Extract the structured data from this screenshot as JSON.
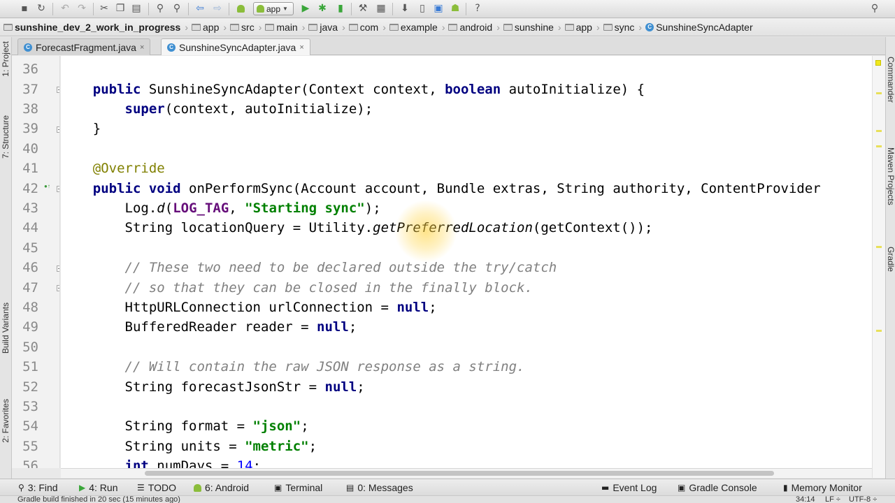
{
  "toolbar": {
    "run_config": "app",
    "icons": [
      "save-icon",
      "sync-icon",
      "undo-icon",
      "redo-icon",
      "cut-icon",
      "copy-icon",
      "paste-icon",
      "find-icon",
      "replace-icon",
      "back-icon",
      "forward-icon",
      "android-icon",
      "run-icon",
      "debug-icon",
      "attach-icon",
      "build-icon",
      "project-structure-icon",
      "sdk-manager-icon",
      "avd-manager-icon",
      "android-monitor-icon",
      "help-icon",
      "search-everywhere-icon"
    ]
  },
  "breadcrumb": [
    "sunshine_dev_2_work_in_progress",
    "app",
    "src",
    "main",
    "java",
    "com",
    "example",
    "android",
    "sunshine",
    "app",
    "sync",
    "SunshineSyncAdapter"
  ],
  "editor_tabs": [
    {
      "label": "ForecastFragment.java",
      "close": "×"
    },
    {
      "label": "SunshineSyncAdapter.java",
      "close": "×"
    }
  ],
  "left_tabs": {
    "project": "1: Project",
    "structure": "7: Structure",
    "build_variants": "Build Variants",
    "favorites": "2: Favorites"
  },
  "right_tabs": {
    "commander": "Commander",
    "maven": "Maven Projects",
    "gradle": "Gradle"
  },
  "code_lines": [
    {
      "num": "36",
      "text": ""
    },
    {
      "num": "37",
      "text": "public SunshineSyncAdapter(Context context, boolean autoInitialize) {"
    },
    {
      "num": "38",
      "text": "    super(context, autoInitialize);"
    },
    {
      "num": "39",
      "text": "}"
    },
    {
      "num": "40",
      "text": ""
    },
    {
      "num": "41",
      "text": "@Override"
    },
    {
      "num": "42",
      "text": "public void onPerformSync(Account account, Bundle extras, String authority, ContentProvider"
    },
    {
      "num": "43",
      "text": "    Log.d(LOG_TAG, \"Starting sync\");"
    },
    {
      "num": "44",
      "text": "    String locationQuery = Utility.getPreferredLocation(getContext());"
    },
    {
      "num": "45",
      "text": ""
    },
    {
      "num": "46",
      "text": "    // These two need to be declared outside the try/catch"
    },
    {
      "num": "47",
      "text": "    // so that they can be closed in the finally block."
    },
    {
      "num": "48",
      "text": "    HttpURLConnection urlConnection = null;"
    },
    {
      "num": "49",
      "text": "    BufferedReader reader = null;"
    },
    {
      "num": "50",
      "text": ""
    },
    {
      "num": "51",
      "text": "    // Will contain the raw JSON response as a string."
    },
    {
      "num": "52",
      "text": "    String forecastJsonStr = null;"
    },
    {
      "num": "53",
      "text": ""
    },
    {
      "num": "54",
      "text": "    String format = \"json\";"
    },
    {
      "num": "55",
      "text": "    String units = \"metric\";"
    },
    {
      "num": "56",
      "text": "    int numDays = 14;"
    }
  ],
  "bottom_tools": {
    "find": "3: Find",
    "run": "4: Run",
    "todo": "TODO",
    "android": "6: Android",
    "terminal": "Terminal",
    "messages": "0: Messages",
    "event_log": "Event Log",
    "gradle_console": "Gradle Console",
    "memory_monitor": "Memory Monitor"
  },
  "status": {
    "message": "Gradle build finished in 20 sec (15 minutes ago)",
    "position": "34:14",
    "line_sep": "LF ÷",
    "encoding": "UTF-8 ÷"
  },
  "colors": {
    "keyword": "#000080",
    "string": "#008000",
    "comment": "#808080",
    "annotation": "#808000",
    "number": "#0000ff",
    "constant": "#660e7a"
  }
}
